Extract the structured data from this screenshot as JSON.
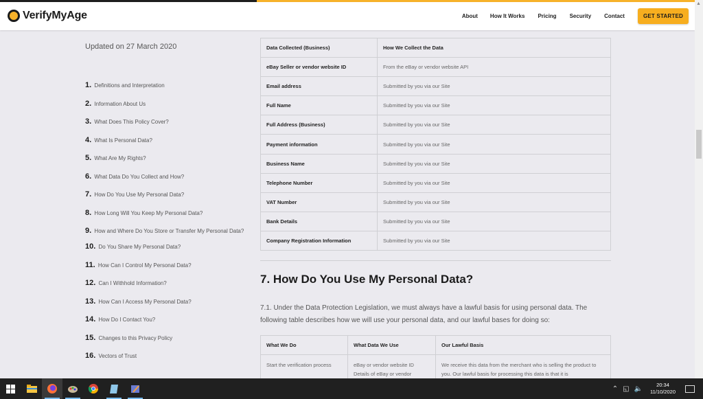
{
  "header": {
    "brand": "VerifyMyAge",
    "nav": [
      "About",
      "How It Works",
      "Pricing",
      "Security",
      "Contact"
    ],
    "cta": "GET STARTED",
    "accent_color": "#f7b22a",
    "reading_progress": 0.37
  },
  "sidebar": {
    "updated": "Updated on 27 March 2020",
    "toc": [
      {
        "num": "1.",
        "label": "Definitions and Interpretation"
      },
      {
        "num": "2.",
        "label": "Information About Us"
      },
      {
        "num": "3.",
        "label": "What Does This Policy Cover?"
      },
      {
        "num": "4.",
        "label": "What Is Personal Data?"
      },
      {
        "num": "5.",
        "label": "What Are My Rights?"
      },
      {
        "num": "6.",
        "label": "What Data Do You Collect and How?"
      },
      {
        "num": "7.",
        "label": "How Do You Use My Personal Data?"
      },
      {
        "num": "8.",
        "label": "How Long Will You Keep My Personal Data?"
      },
      {
        "num": "9.",
        "label": "How and Where Do You Store or Transfer My Personal Data?"
      },
      {
        "num": "10.",
        "label": "Do You Share My Personal Data?"
      },
      {
        "num": "11.",
        "label": "How Can I Control My Personal Data?"
      },
      {
        "num": "12.",
        "label": "Can I Withhold Information?"
      },
      {
        "num": "13.",
        "label": "How Can I Access My Personal Data?"
      },
      {
        "num": "14.",
        "label": "How Do I Contact You?"
      },
      {
        "num": "15.",
        "label": "Changes to this Privacy Policy"
      },
      {
        "num": "16.",
        "label": "Vectors of Trust"
      }
    ]
  },
  "business_table": {
    "headers": [
      "Data Collected (Business)",
      "How We Collect the Data"
    ],
    "rows": [
      [
        "eBay Seller or vendor website ID",
        "From the eBay or vendor website API"
      ],
      [
        "Email address",
        "Submitted by you via our Site"
      ],
      [
        "Full Name",
        "Submitted by you via our Site"
      ],
      [
        "Full Address (Business)",
        "Submitted by you via our Site"
      ],
      [
        "Payment information",
        "Submitted by you via our Site"
      ],
      [
        "Business Name",
        "Submitted by you via our Site"
      ],
      [
        "Telephone Number",
        "Submitted by you via our Site"
      ],
      [
        "VAT Number",
        "Submitted by you via our Site"
      ],
      [
        "Bank Details",
        "Submitted by you via our Site"
      ],
      [
        "Company Registration Information",
        "Submitted by you via our Site"
      ]
    ]
  },
  "section7": {
    "title": "7. How Do You Use My Personal Data?",
    "paragraph": "7.1. Under the Data Protection Legislation, we must always have a lawful basis for using personal data. The following table describes how we will use your personal data, and our lawful bases for doing so:"
  },
  "usage_table": {
    "headers": [
      "What We Do",
      "What Data We Use",
      "Our Lawful Basis"
    ],
    "rows": [
      [
        "Start the verification process",
        "eBay or vendor website ID\nDetails of eBay or vendor",
        "We receive this data from the merchant who is selling the product to you. Our lawful basis for processing this data is that it is"
      ]
    ]
  },
  "taskbar": {
    "apps": [
      "windows-start",
      "file-explorer",
      "firefox",
      "paint",
      "chrome",
      "notepad",
      "app"
    ],
    "time": "20:34",
    "date": "11/10/2020"
  }
}
